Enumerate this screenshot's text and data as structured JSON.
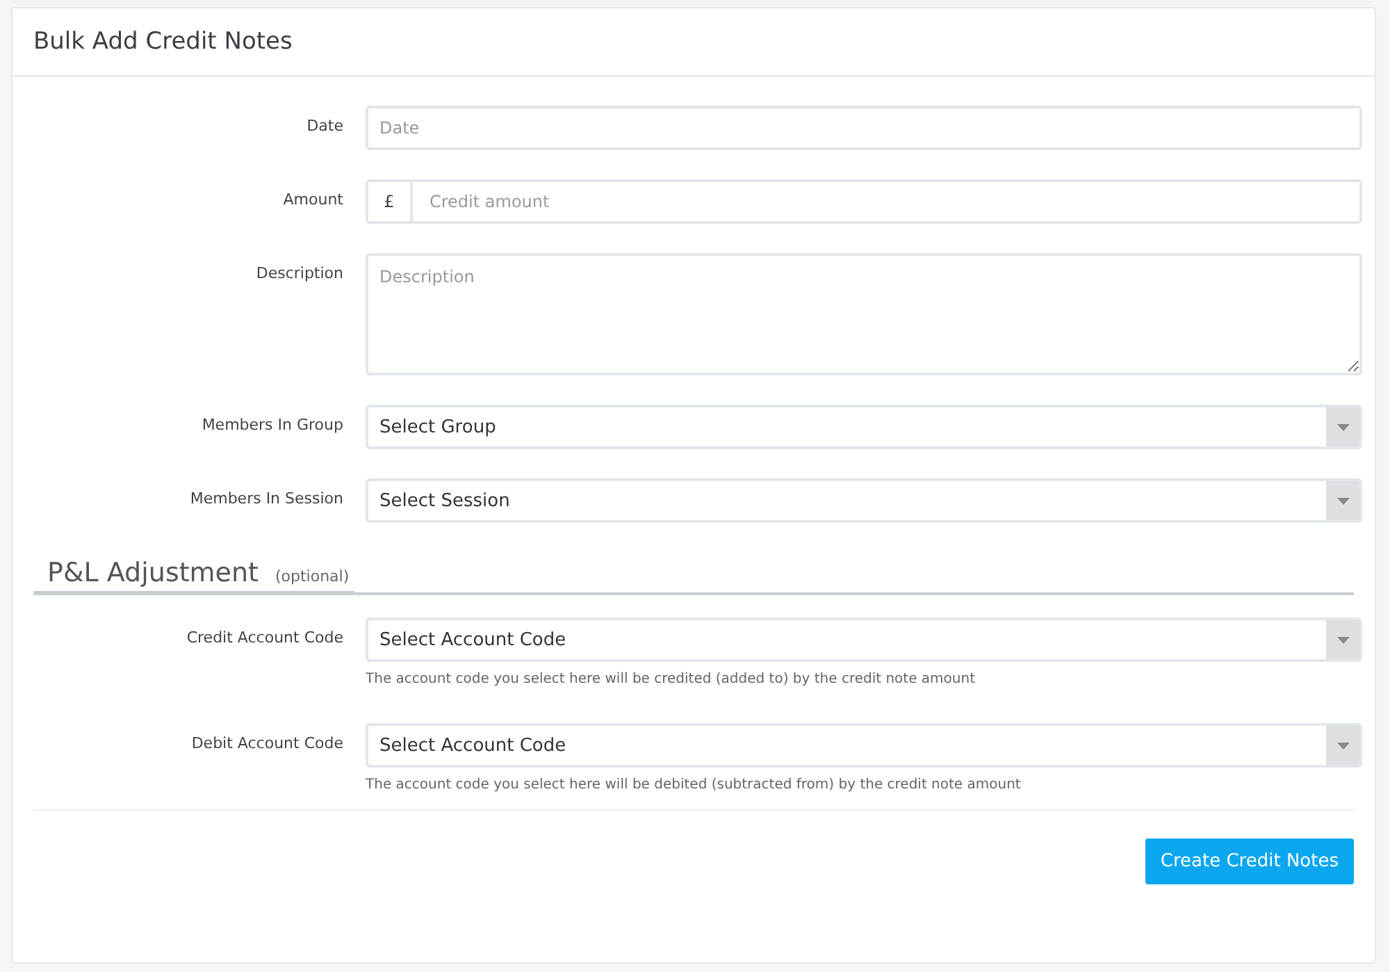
{
  "panel": {
    "title": "Bulk Add Credit Notes"
  },
  "fields": [
    {
      "kind": "text",
      "label": "Date",
      "placeholder": "Date"
    },
    {
      "kind": "addon",
      "label": "Amount",
      "addon": "£",
      "placeholder": "Credit amount"
    },
    {
      "kind": "textarea",
      "label": "Description",
      "placeholder": "Description"
    },
    {
      "kind": "select",
      "label": "Members In Group",
      "value": "Select Group"
    },
    {
      "kind": "select",
      "label": "Members In Session",
      "value": "Select Session"
    }
  ],
  "section": {
    "title": "P&L Adjustment",
    "note": "(optional)"
  },
  "adjustments": [
    {
      "kind": "select",
      "label": "Credit Account Code",
      "value": "Select Account Code",
      "help": "The account code you select here will be credited (added to) by the credit note amount"
    },
    {
      "kind": "select",
      "label": "Debit Account Code",
      "value": "Select Account Code",
      "help": "The account code you select here will be debited (subtracted from) by the credit note amount"
    }
  ],
  "submit": "Create Credit Notes"
}
